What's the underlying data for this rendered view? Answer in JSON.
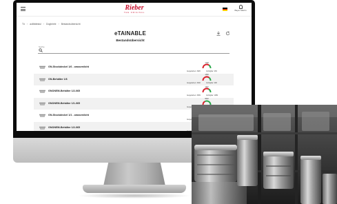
{
  "header": {
    "logo": "Rieber",
    "logo_tagline": "THE ORIGINAL",
    "user_label": "Bayer Martin",
    "flag_colors": [
      "#000000",
      "#dd0000",
      "#ffce00"
    ]
  },
  "breadcrumb": [
    "Tö",
    "acilitätestul",
    "Dogbriele",
    "Bestandsübersicht"
  ],
  "page": {
    "brand": "eTAINABLE",
    "subtitle": "Bestandsübersicht"
  },
  "search": {
    "label": "Suche",
    "value": ""
  },
  "stock_items": [
    {
      "name": "GN-Stockdeckel 1/6 - wasserdicht",
      "value": "1728",
      "issued": "Ausgeliehen: 3026",
      "available": "Verfügbar: 239",
      "level": 0.7
    },
    {
      "name": "GN-Behälter 1/6",
      "value": "1366",
      "issued": "Ausgeliehen: 3040",
      "available": "Verfügbar: 208",
      "level": 0.72
    },
    {
      "name": "GNONEM-Behälter 1/2-065",
      "value": "1467",
      "issued": "Ausgeliehen: 3039",
      "available": "Verfügbar: 1089",
      "level": 0.68
    },
    {
      "name": "GNONEM-Behälter 1/1-065",
      "value": "6640",
      "issued": "Ausgeliehen: 3042",
      "available": "Verfügbar: 2088",
      "level": 0.35
    },
    {
      "name": "GN-Stockdeckel 1/1 - wasserdicht",
      "value": "2116",
      "issued": "Ausgeliehen: 1127",
      "available": "Verfügbar: 3006",
      "level": 0.4
    },
    {
      "name": "GNONEM-Behälter 1/2-065",
      "value": "1733",
      "issued": "Ausgeliehen: 1065",
      "available": "Verfügbar: 2094",
      "level": 0.55
    }
  ],
  "colors": {
    "accent": "#c8102e",
    "gauge_red": "#d9232d",
    "gauge_green": "#2aa84a",
    "row_alt": "#f1f1f1"
  }
}
